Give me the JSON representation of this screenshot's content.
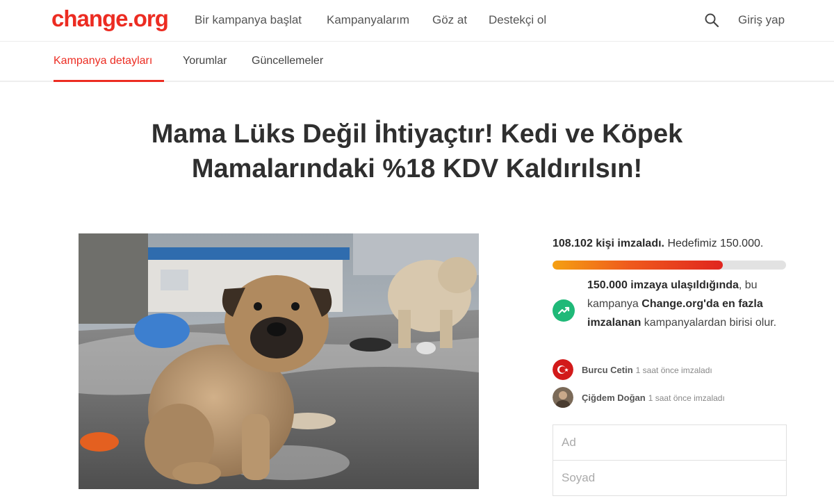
{
  "header": {
    "logo": "change.org",
    "nav": [
      "Bir kampanya başlat",
      "Kampanyalarım",
      "Göz at",
      "Destekçi ol"
    ],
    "login": "Giriş yap"
  },
  "tabs": [
    "Kampanya detayları",
    "Yorumlar",
    "Güncellemeler"
  ],
  "petition": {
    "title_line1": "Mama Lüks Değil İhtiyaçtır! Kedi ve Köpek",
    "title_line2": "Mamalarındaki %18 KDV Kaldırılsın!"
  },
  "sidebar": {
    "signed_count": "108.102 kişi imzaladı.",
    "goal": "Hedefimiz 150.000.",
    "progress_fraction": 0.73,
    "goal_msg_bold1": "150.000 imzaya ulaşıldığında",
    "goal_msg_1": ", bu kampanya ",
    "goal_msg_bold2": "Change.org'da en fazla imzalanan",
    "goal_msg_2": " kampanyalardan birisi olur.",
    "signers": [
      {
        "name": "Burcu Cetin",
        "when": "1 saat önce imzaladı"
      },
      {
        "name": "Çiğdem Doğan",
        "when": "1 saat önce imzaladı"
      }
    ],
    "form": {
      "first_name_placeholder": "Ad",
      "last_name_placeholder": "Soyad"
    }
  },
  "colors": {
    "brand": "#ec2c22",
    "success": "#1fb978"
  }
}
